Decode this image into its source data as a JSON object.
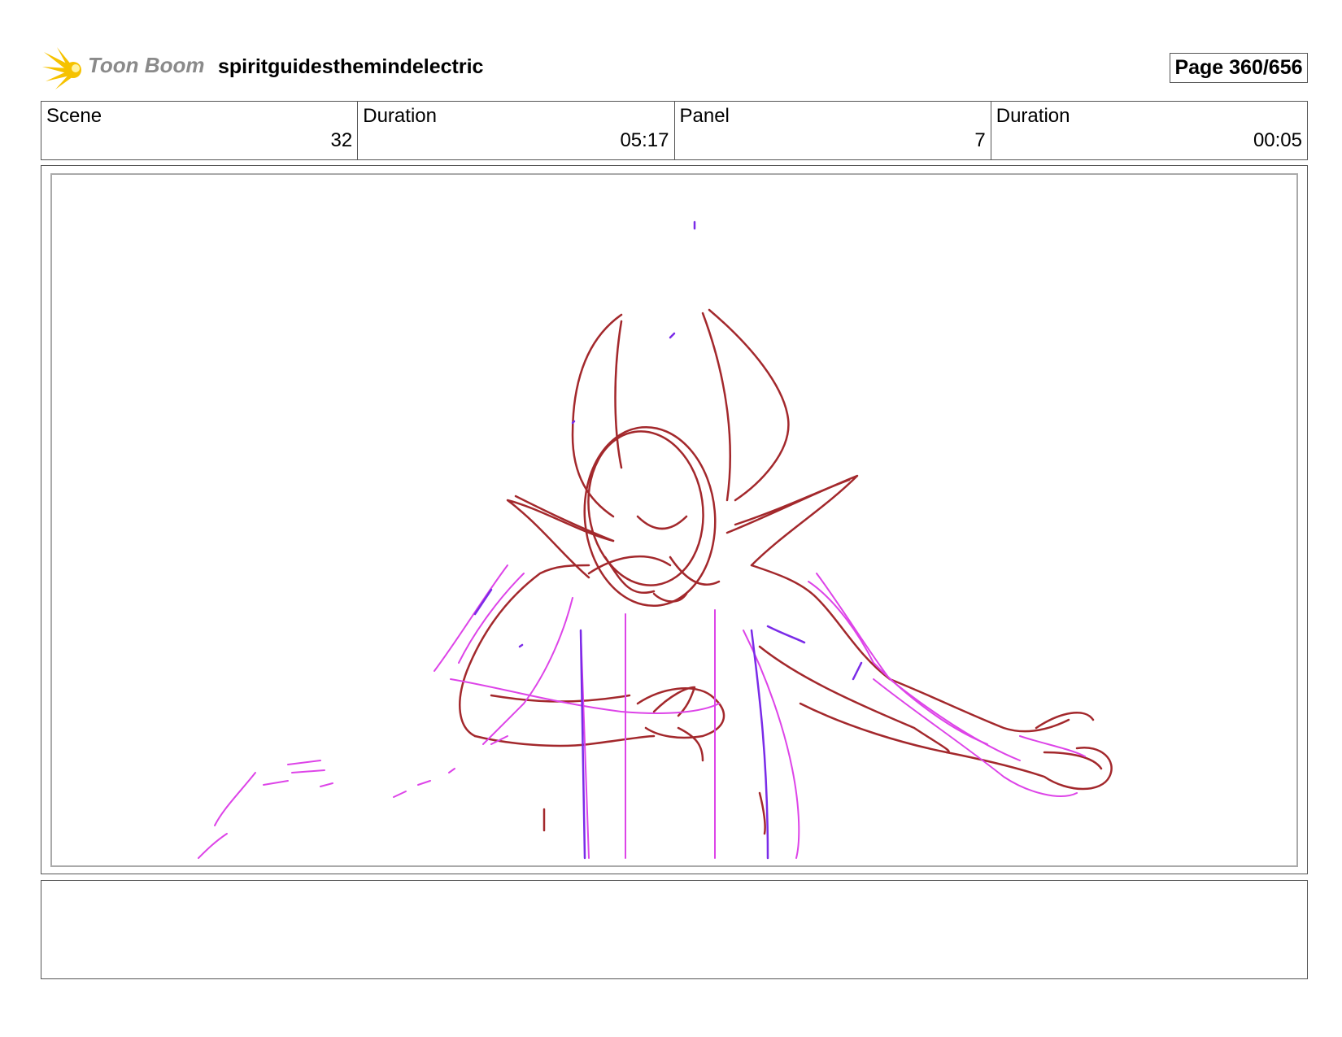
{
  "header": {
    "logo_text": "Toon Boom",
    "project_title": "spiritguidesthemindelectric",
    "page_label": "Page 360/656"
  },
  "info": {
    "scene_label": "Scene",
    "scene_value": "32",
    "scene_duration_label": "Duration",
    "scene_duration_value": "05:17",
    "panel_label": "Panel",
    "panel_value": "7",
    "panel_duration_label": "Duration",
    "panel_duration_value": "00:05"
  },
  "notes": {
    "text": ""
  },
  "colors": {
    "sketch_red": "#a3282c",
    "sketch_magenta": "#dd44e8",
    "sketch_violet": "#7a2be8",
    "logo_yellow": "#f6c200"
  },
  "icons": {
    "logo": "toon-boom-logo-icon"
  }
}
